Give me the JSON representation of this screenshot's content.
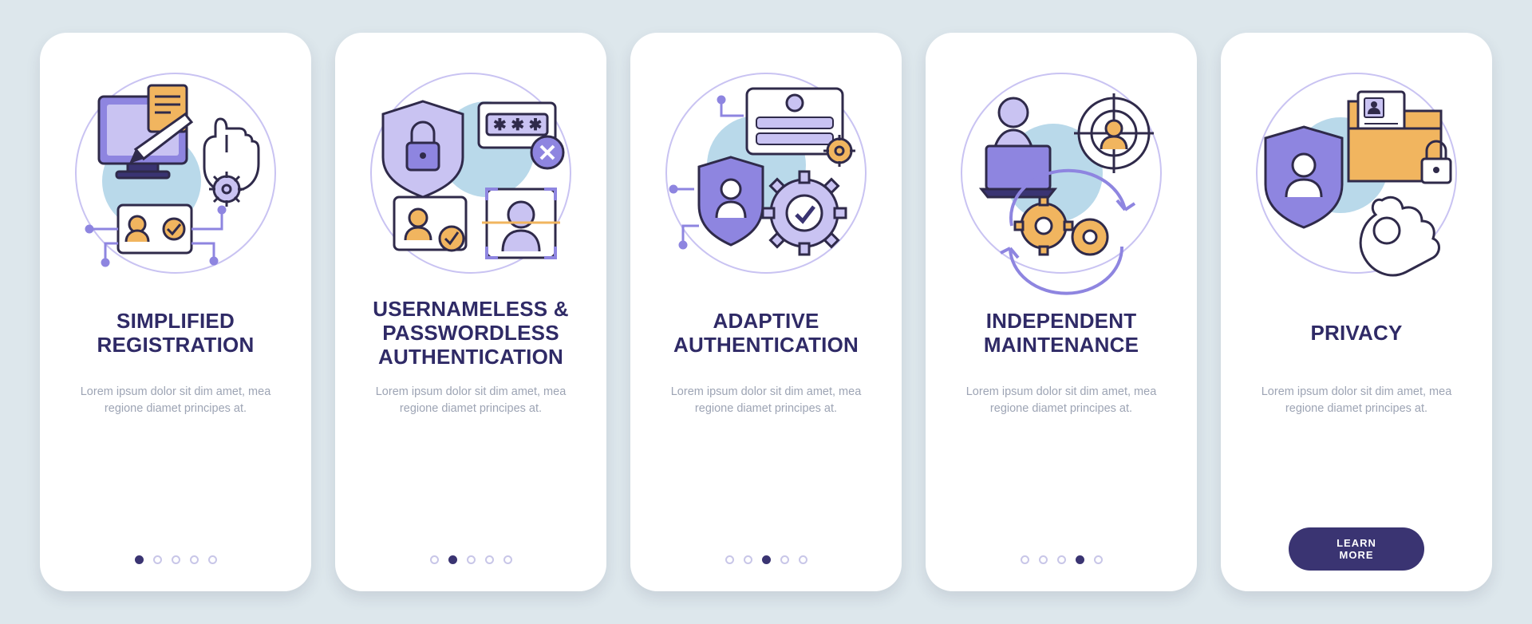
{
  "cards": [
    {
      "title_line1": "Simplified",
      "title_line2": "Registration",
      "desc": "Lorem ipsum dolor sit dim amet, mea regione diamet principes at.",
      "active_dot": 0,
      "icon": "registration-icon"
    },
    {
      "title_line1": "Usernameless &",
      "title_line2": "Passwordless",
      "title_line3": "Authentication",
      "desc": "Lorem ipsum dolor sit dim amet, mea regione diamet principes at.",
      "active_dot": 1,
      "icon": "passwordless-icon"
    },
    {
      "title_line1": "Adaptive",
      "title_line2": "Authentication",
      "desc": "Lorem ipsum dolor sit dim amet, mea regione diamet principes at.",
      "active_dot": 2,
      "icon": "adaptive-icon"
    },
    {
      "title_line1": "Independent",
      "title_line2": "Maintenance",
      "desc": "Lorem ipsum dolor sit dim amet, mea regione diamet principes at.",
      "active_dot": 3,
      "icon": "maintenance-icon"
    },
    {
      "title_line1": "Privacy",
      "desc": "Lorem ipsum dolor sit dim amet, mea regione diamet principes at.",
      "active_dot": 4,
      "icon": "privacy-icon",
      "cta_label": "LEARN MORE"
    }
  ],
  "dot_count": 5,
  "colors": {
    "purple": "#8e85e0",
    "purple_light": "#c9c3f2",
    "purple_dark": "#3a3472",
    "blue": "#b9d9ea",
    "gold": "#f1b55f",
    "line": "#2f2a4a",
    "white": "#ffffff",
    "background": "#dde7ec"
  }
}
